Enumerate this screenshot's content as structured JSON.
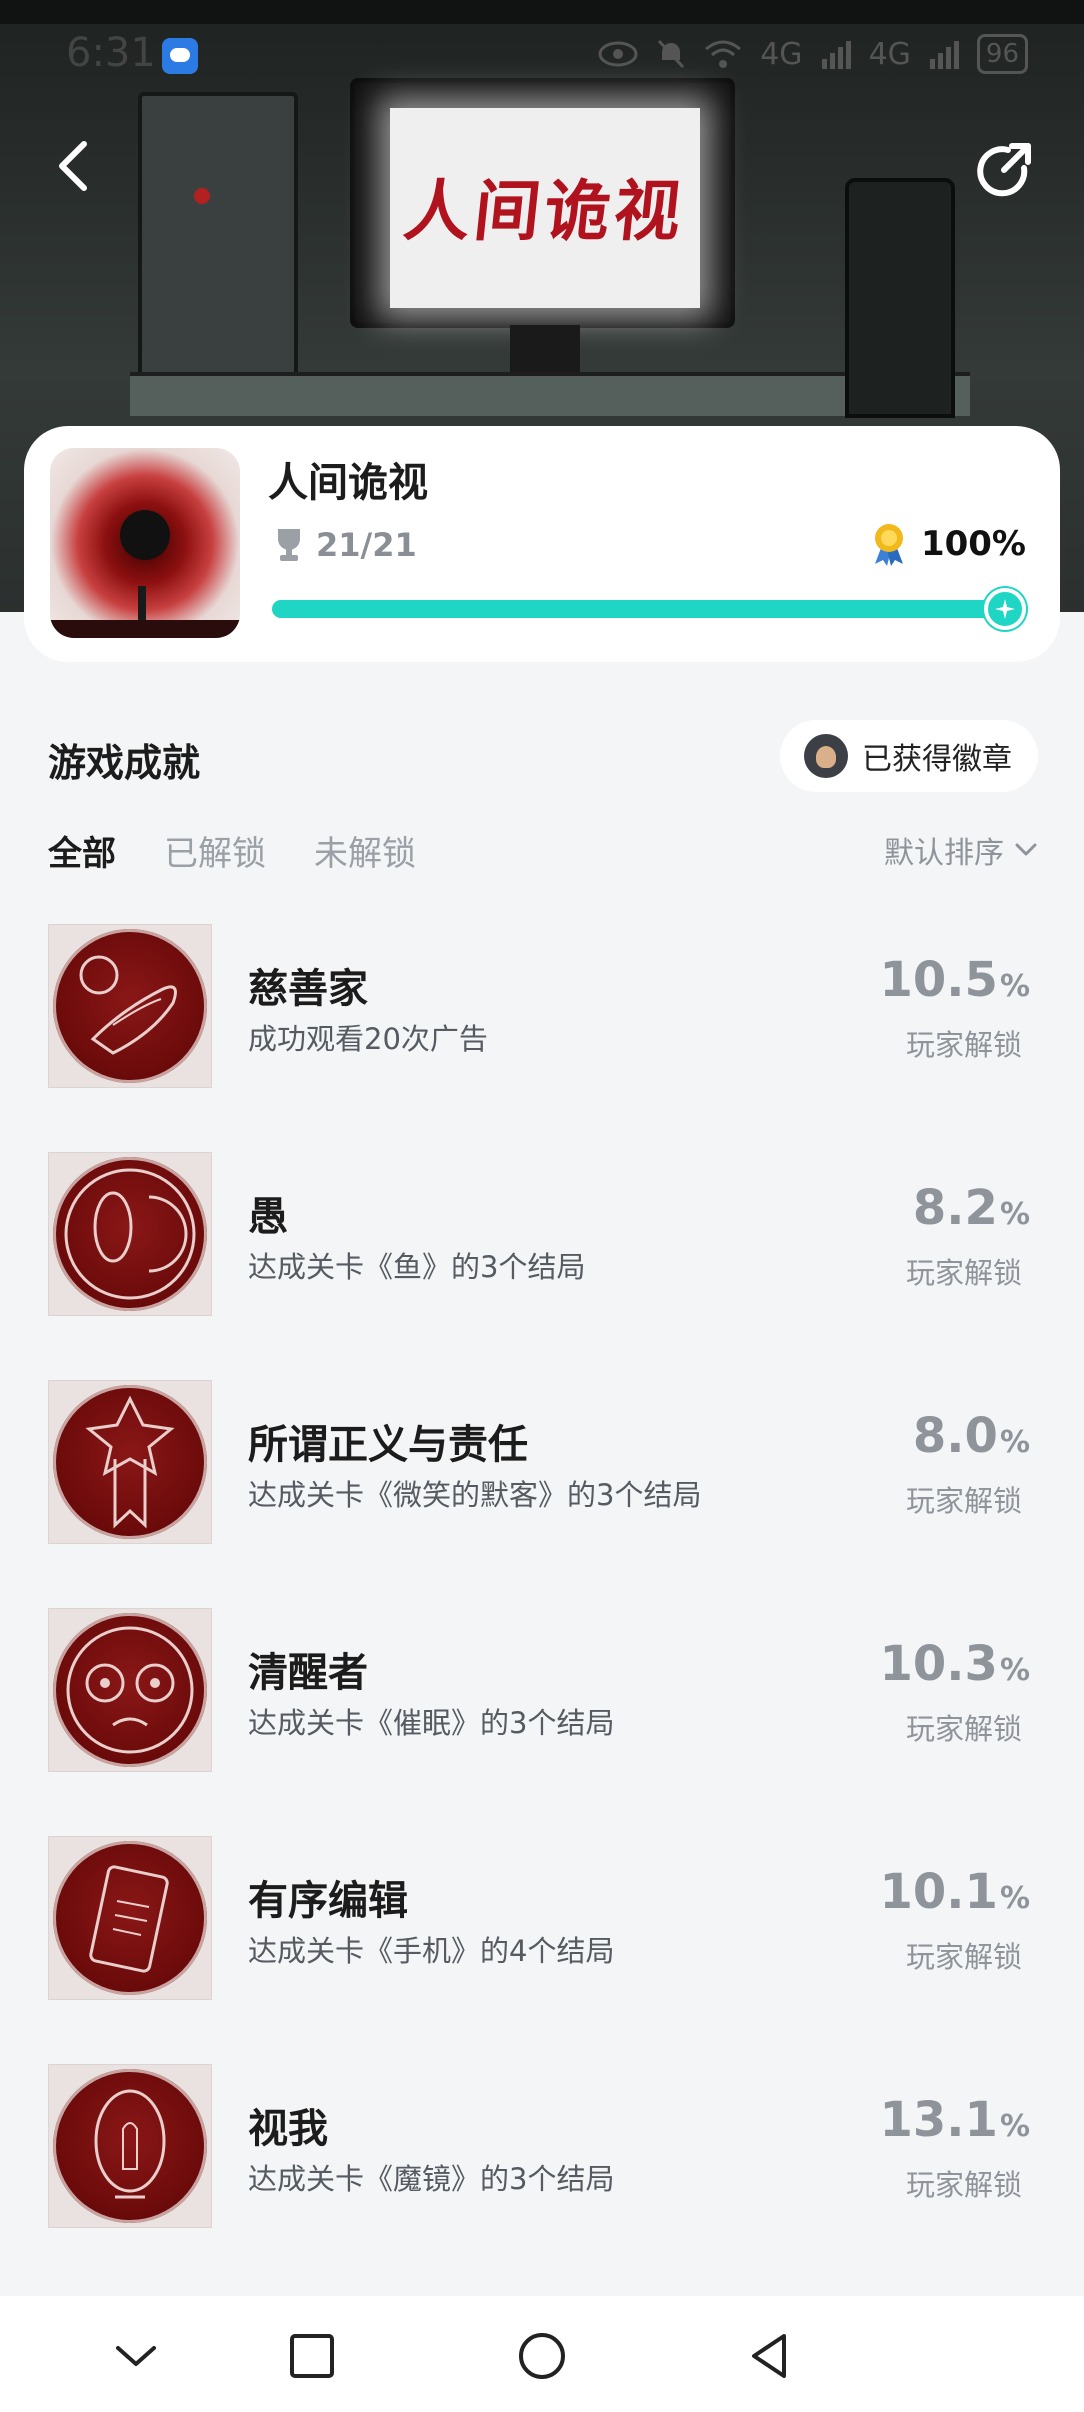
{
  "status_bar": {
    "time": "6:31",
    "signal_1": "4G",
    "signal_2": "4G",
    "battery": "96"
  },
  "hero": {
    "monitor_text": "人间诡视"
  },
  "game": {
    "name": "人间诡视",
    "trophies": "21/21",
    "percent": "100%",
    "progress": 1.0
  },
  "section": {
    "title": "游戏成就",
    "badge_button": "已获得徽章"
  },
  "tabs": [
    {
      "label": "全部",
      "active": true
    },
    {
      "label": "已解锁",
      "active": false
    },
    {
      "label": "未解锁",
      "active": false
    }
  ],
  "sort_label": "默认排序",
  "achievements": [
    {
      "title": "慈善家",
      "desc": "成功观看20次广告",
      "pct": "10.5",
      "unit": "%",
      "sub": "玩家解锁",
      "icon": "hand-coins-icon"
    },
    {
      "title": "愚",
      "desc": "达成关卡《鱼》的3个结局",
      "pct": "8.2",
      "unit": "%",
      "sub": "玩家解锁",
      "icon": "fish-icon"
    },
    {
      "title": "所谓正义与责任",
      "desc": "达成关卡《微笑的默客》的3个结局",
      "pct": "8.0",
      "unit": "%",
      "sub": "玩家解锁",
      "icon": "banner-web-icon"
    },
    {
      "title": "清醒者",
      "desc": "达成关卡《催眠》的3个结局",
      "pct": "10.3",
      "unit": "%",
      "sub": "玩家解锁",
      "icon": "wide-eyes-face-icon"
    },
    {
      "title": "有序编辑",
      "desc": "达成关卡《手机》的4个结局",
      "pct": "10.1",
      "unit": "%",
      "sub": "玩家解锁",
      "icon": "phone-icon"
    },
    {
      "title": "视我",
      "desc": "达成关卡《魔镜》的3个结局",
      "pct": "13.1",
      "unit": "%",
      "sub": "玩家解锁",
      "icon": "mirror-icon"
    }
  ],
  "colors": {
    "accent": "#1fd6c4",
    "badge_red": "#6a0a0a",
    "background": "#f4f5f7"
  }
}
